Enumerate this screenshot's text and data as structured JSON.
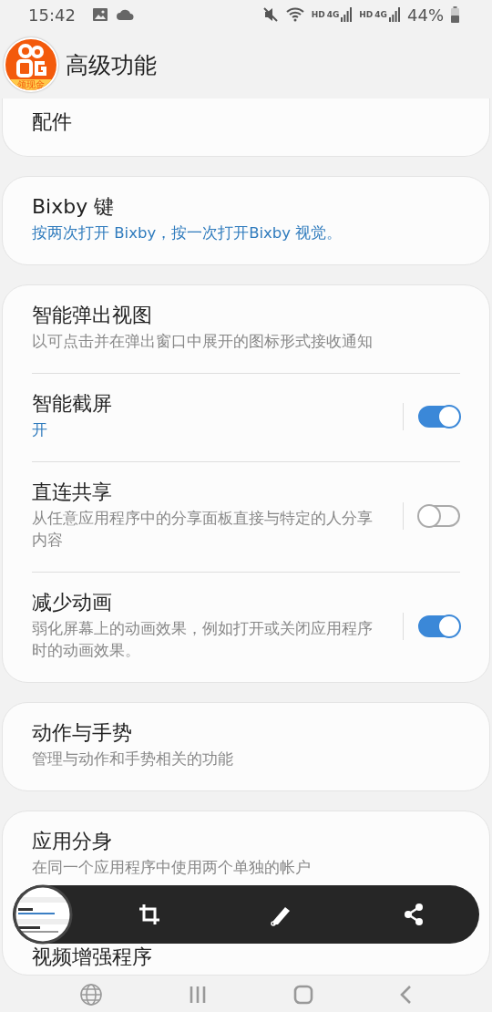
{
  "status_bar": {
    "time": "15:42",
    "network_labels": [
      "HD",
      "4G",
      "HD",
      "4G"
    ],
    "battery": "44%"
  },
  "header": {
    "title": "高级功能",
    "badge_text": "领现金"
  },
  "groups": [
    {
      "cut_top": true,
      "items": [
        {
          "kind": "link",
          "title": "配件"
        }
      ]
    },
    {
      "cut_top": false,
      "items": [
        {
          "kind": "link",
          "title": "Bixby 键",
          "subtitle": "按两次打开 Bixby，按一次打开Bixby 视觉。",
          "accent": true
        }
      ]
    },
    {
      "cut_top": false,
      "items": [
        {
          "kind": "link",
          "title": "智能弹出视图",
          "subtitle": "以可点击并在弹出窗口中展开的图标形式接收通知",
          "accent": false
        },
        {
          "kind": "switch",
          "title": "智能截屏",
          "subtitle": "开",
          "accent": true,
          "on": true
        },
        {
          "kind": "switch",
          "title": "直连共享",
          "subtitle": "从任意应用程序中的分享面板直接与特定的人分享内容",
          "accent": false,
          "on": false
        },
        {
          "kind": "switch",
          "title": "减少动画",
          "subtitle": "弱化屏幕上的动画效果，例如打开或关闭应用程序时的动画效果。",
          "accent": false,
          "on": true
        }
      ]
    },
    {
      "cut_top": false,
      "items": [
        {
          "kind": "link",
          "title": "动作与手势",
          "subtitle": "管理与动作和手势相关的功能",
          "accent": false
        }
      ]
    },
    {
      "cut_top": false,
      "items": [
        {
          "kind": "link",
          "title": "应用分身",
          "subtitle": "在同一个应用程序中使用两个单独的帐户",
          "accent": false
        },
        {
          "kind": "link",
          "title": "视频增强程序"
        }
      ]
    }
  ],
  "screenshot_toolbar": {
    "buttons": [
      {
        "kind": "crop"
      },
      {
        "kind": "edit"
      },
      {
        "kind": "share"
      }
    ]
  },
  "nav_bar": [
    {
      "kind": "globe"
    },
    {
      "kind": "recents"
    },
    {
      "kind": "home"
    },
    {
      "kind": "back"
    }
  ]
}
